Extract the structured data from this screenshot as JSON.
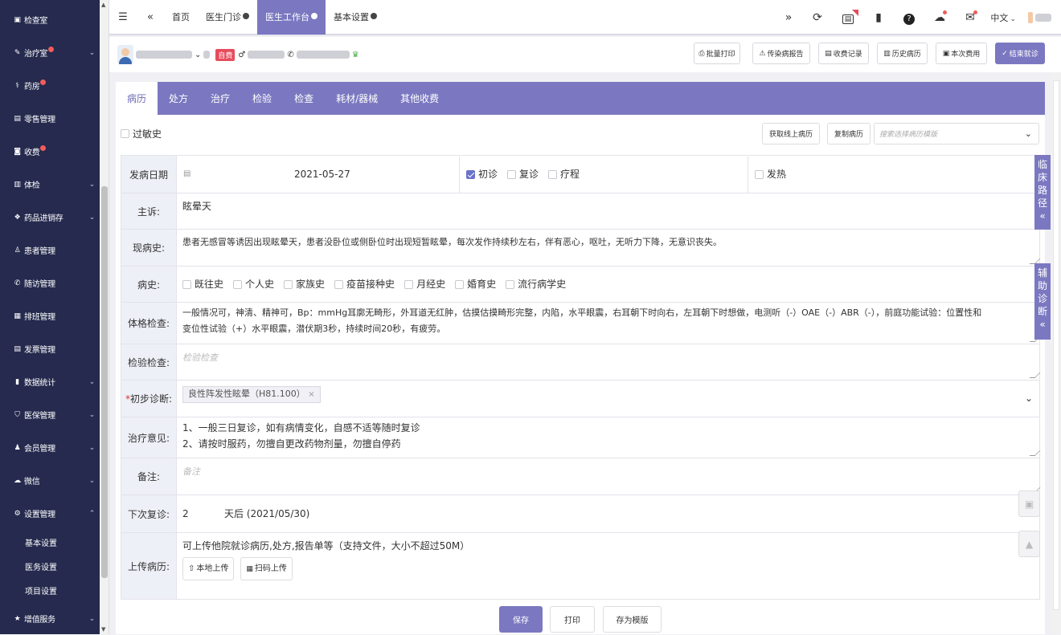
{
  "sidebar": {
    "items": [
      {
        "icon": "▣",
        "label": "检查室",
        "badge": false,
        "chev": false
      },
      {
        "icon": "✎",
        "label": "治疗室",
        "badge": true,
        "chev": true
      },
      {
        "icon": "⚕",
        "label": "药房",
        "badge": true,
        "chev": false
      },
      {
        "icon": "▤",
        "label": "零售管理",
        "badge": false,
        "chev": false
      },
      {
        "icon": "◙",
        "label": "收费",
        "badge": true,
        "chev": false
      },
      {
        "icon": "▥",
        "label": "体检",
        "badge": false,
        "chev": true
      },
      {
        "icon": "❖",
        "label": "药品进销存",
        "badge": false,
        "chev": true
      },
      {
        "icon": "♙",
        "label": "患者管理",
        "badge": false,
        "chev": false
      },
      {
        "icon": "✆",
        "label": "随访管理",
        "badge": false,
        "chev": false
      },
      {
        "icon": "▦",
        "label": "排班管理",
        "badge": false,
        "chev": false
      },
      {
        "icon": "▤",
        "label": "发票管理",
        "badge": false,
        "chev": false
      },
      {
        "icon": "▮",
        "label": "数据统计",
        "badge": false,
        "chev": true
      },
      {
        "icon": "⛉",
        "label": "医保管理",
        "badge": false,
        "chev": true
      },
      {
        "icon": "♟",
        "label": "会员管理",
        "badge": false,
        "chev": true
      },
      {
        "icon": "☁",
        "label": "微信",
        "badge": false,
        "chev": true
      },
      {
        "icon": "⚙",
        "label": "设置管理",
        "badge": false,
        "chev": true,
        "expanded": true
      }
    ],
    "subitems": [
      "基本设置",
      "医务设置",
      "项目设置"
    ],
    "last": {
      "icon": "★",
      "label": "增值服务",
      "chev": true
    }
  },
  "topbar": {
    "menu_icon": "☰",
    "collapse_icon": "«",
    "tabs": [
      {
        "label": "首页",
        "close": false,
        "active": false
      },
      {
        "label": "医生门诊",
        "close": true,
        "active": false
      },
      {
        "label": "医生工作台",
        "close": true,
        "active": true
      },
      {
        "label": "基本设置",
        "close": true,
        "active": false
      }
    ],
    "more_icon": "»",
    "language": "中文"
  },
  "patient": {
    "self_pay": "自费"
  },
  "actions": [
    "批量打印",
    "传染病报告",
    "收费记录",
    "历史病历",
    "本次费用",
    "结束就诊"
  ],
  "main_tabs": [
    "病历",
    "处方",
    "治疗",
    "检验",
    "检查",
    "耗材/器械",
    "其他收费"
  ],
  "allergy": {
    "label": "过敏史"
  },
  "tools": {
    "fetch_online": "获取线上病历",
    "copy": "复制病历",
    "template_placeholder": "搜索选择病历模版"
  },
  "form": {
    "onset": {
      "label": "发病日期",
      "date": "2021-05-27",
      "visit": [
        {
          "label": "初诊",
          "checked": true
        },
        {
          "label": "复诊",
          "checked": false
        },
        {
          "label": "疗程",
          "checked": false
        }
      ],
      "fever": "发热"
    },
    "complaint": {
      "label": "主诉:",
      "value": "眩晕天"
    },
    "present": {
      "label": "现病史:",
      "value": "患者无感冒等诱因出现眩晕天，患者没卧位或侧卧位时出现短暂眩晕，每次发作持续秒左右，伴有恶心，呕吐，无听力下降，无意识丧失。"
    },
    "history": {
      "label": "病史:",
      "items": [
        "既往史",
        "个人史",
        "家族史",
        "疫苗接种史",
        "月经史",
        "婚育史",
        "流行病学史"
      ]
    },
    "physical": {
      "label": "体格检查:",
      "line1": "一般情况可，神清、精神可，Bp：mmHg耳廓无畸形，外耳道无红肿，估摸估摸畸形完整，内陷，水平眼震，右耳朝下时向右，左耳朝下时想做，电测听（-）OAE（-）ABR（-），前庭功能试验：位置性和",
      "line2": "变位性试验（+）水平眼震，潜伏期3秒，持续时间20秒，有疲劳。"
    },
    "lab": {
      "label": "检验检查:",
      "placeholder": "检验检查"
    },
    "diagnosis": {
      "label": "初步诊断:",
      "tag": "良性阵发性眩晕（H81.100）"
    },
    "treatment": {
      "label": "治疗意见:",
      "line1": "1、一般三日复诊，如有病情变化，自感不适等随时复诊",
      "line2": "2、请按时服药，勿擅自更改药物剂量，勿擅自停药"
    },
    "remark": {
      "label": "备注:",
      "placeholder": "备注"
    },
    "next": {
      "label": "下次复诊:",
      "days": "2",
      "text": "天后 (2021/05/30)"
    },
    "upload": {
      "label": "上传病历:",
      "hint": "可上传他院就诊病历,处方,报告单等（支持文件，大小不超过50M）",
      "local": "本地上传",
      "scan": "扫码上传"
    }
  },
  "side_tabs": {
    "clinical": [
      "临",
      "床",
      "路",
      "径"
    ],
    "assist": [
      "辅",
      "助",
      "诊",
      "断"
    ]
  },
  "bottom": {
    "save": "保存",
    "print": "打印",
    "save_template": "存为模版"
  }
}
